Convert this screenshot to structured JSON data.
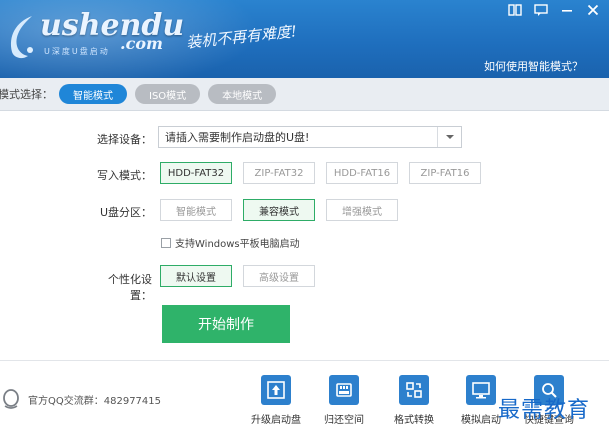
{
  "header": {
    "logo_text": "ushendu",
    "logo_tld": ".com",
    "logo_sub": "U深度U盘启动",
    "slogan": "装机不再有难度!",
    "help_link": "如何使用智能模式？"
  },
  "mode_bar": {
    "label": "模式选择：",
    "tabs": [
      {
        "label": "智能模式",
        "active": true
      },
      {
        "label": "ISO模式",
        "active": false
      },
      {
        "label": "本地模式",
        "active": false
      }
    ]
  },
  "form": {
    "device_label": "选择设备：",
    "device_value": "请插入需要制作启动盘的U盘!",
    "write_label": "写入模式：",
    "write_options": [
      "HDD-FAT32",
      "ZIP-FAT32",
      "HDD-FAT16",
      "ZIP-FAT16"
    ],
    "write_selected": "HDD-FAT32",
    "partition_label": "U盘分区：",
    "partition_options": [
      "智能模式",
      "兼容模式",
      "增强模式"
    ],
    "partition_selected": "兼容模式",
    "checkbox_label": "支持Windows平板电脑启动",
    "checkbox_checked": false,
    "personal_label": "个性化设置：",
    "personal_options": [
      "默认设置",
      "高级设置"
    ],
    "personal_selected": "默认设置",
    "start_button": "开始制作"
  },
  "footer": {
    "qq_text": "官方QQ交流群：482977415",
    "tools": [
      {
        "label": "升级启动盘",
        "icon": "upgrade-icon"
      },
      {
        "label": "归还空间",
        "icon": "restore-space-icon"
      },
      {
        "label": "格式转换",
        "icon": "format-convert-icon"
      },
      {
        "label": "模拟启动",
        "icon": "simulate-boot-icon"
      },
      {
        "label": "快捷键查询",
        "icon": "search-icon"
      }
    ]
  },
  "watermark": "最需教育",
  "colors": {
    "header_blue": "#1f6fbe",
    "active_tab": "#1f86d8",
    "selected_green": "#2eac67",
    "start_button": "#2fb36a",
    "tool_icon_blue": "#2d80cd"
  }
}
